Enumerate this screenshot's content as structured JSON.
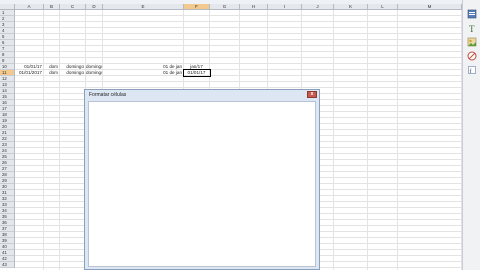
{
  "columns": [
    "A",
    "B",
    "C",
    "D",
    "E",
    "F",
    "G",
    "H",
    "I",
    "J",
    "K",
    "L",
    "M"
  ],
  "active_column": "F",
  "rows": [
    "1",
    "2",
    "3",
    "4",
    "5",
    "6",
    "7",
    "8",
    "9",
    "10",
    "11",
    "12",
    "13",
    "14",
    "15",
    "16",
    "17",
    "18",
    "19",
    "20",
    "21",
    "22",
    "23",
    "24",
    "25",
    "26",
    "27",
    "28",
    "29",
    "30",
    "31",
    "32",
    "33",
    "34",
    "35",
    "36",
    "37",
    "38",
    "39",
    "40",
    "41",
    "42",
    "43"
  ],
  "active_row": "11",
  "cells": {
    "r10": {
      "A": "01/01/17",
      "B": "dom",
      "C": "domingo",
      "D": "domingo, 01 de janeiro de 2017",
      "E": "01 de jan",
      "F": "jan/17"
    },
    "r11": {
      "A": "01/01/2017",
      "B": "dom",
      "C": "domingo",
      "D": "domingo, 01 de janeiro de 2017",
      "E": "01 de jan",
      "F": "01/01/17"
    }
  },
  "dialog": {
    "title": "Formatar células",
    "close_glyph": "x"
  },
  "sidebar_icons": [
    "properties-icon",
    "styles-icon",
    "gallery-icon",
    "navigator-icon",
    "functions-icon"
  ]
}
